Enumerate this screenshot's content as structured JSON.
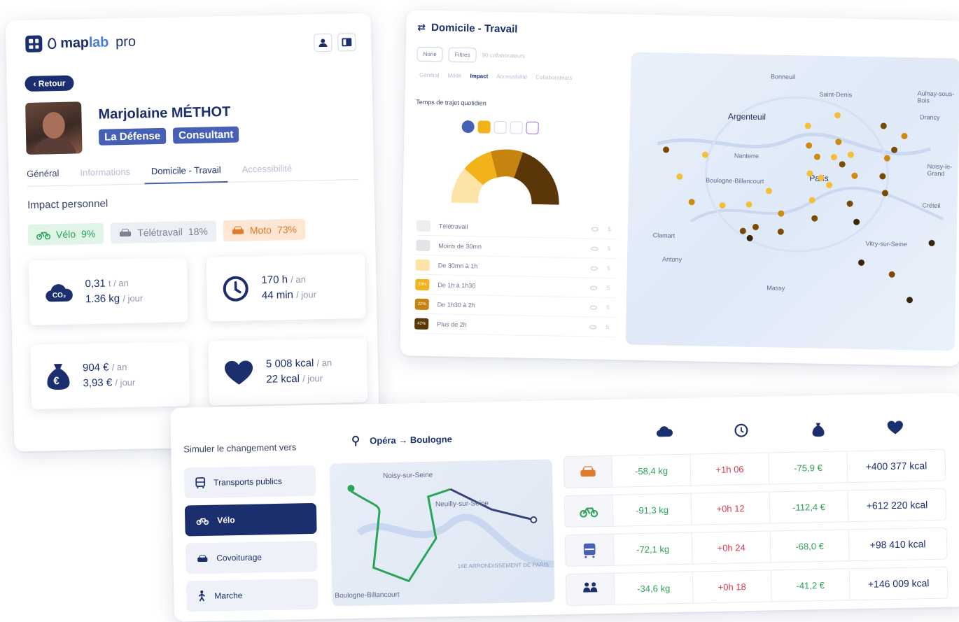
{
  "profile": {
    "brand_map": "map",
    "brand_lab": "lab",
    "brand_pro": "pro",
    "back_label": "‹ Retour",
    "name": "Marjolaine MÉTHOT",
    "tags": [
      "La Défense",
      "Consultant"
    ],
    "tabs": [
      "Général",
      "Informations",
      "Domicile - Travail",
      "Accessibilité"
    ],
    "active_tab": "Domicile - Travail",
    "impact_title": "Impact personnel",
    "modes": [
      {
        "icon": "bike-icon",
        "label": "Vélo",
        "pct": "9%",
        "color": "#2aa457"
      },
      {
        "icon": "car-icon",
        "label": "Télétravail",
        "pct": "18%",
        "color": "#7a8396"
      },
      {
        "icon": "car-icon",
        "label": "Moto",
        "pct": "73%",
        "color": "#e07a2c"
      }
    ],
    "stats": {
      "co2": {
        "v1": "0,31",
        "u1": "t / an",
        "v2": "1.36 kg",
        "u2": "/ jour"
      },
      "time": {
        "v1": "170 h",
        "u1": "/ an",
        "v2": "44 min",
        "u2": "/ jour"
      },
      "money": {
        "v1": "904 €",
        "u1": "/ an",
        "v2": "3,93 €",
        "u2": "/ jour"
      },
      "kcal": {
        "v1": "5 008 kcal",
        "u1": "/ an",
        "v2": "22 kcal",
        "u2": "/ jour"
      }
    }
  },
  "domicile": {
    "title": "Domicile - Travail",
    "filters": [
      "None",
      "Filtres"
    ],
    "collab_count": "90 collaborateurs",
    "tabs": [
      "Général",
      "Mode",
      "Impact",
      "Accessibilité",
      "Collaborateurs"
    ],
    "active_tab": "Impact",
    "chart_title": "Temps de trajet quotidien",
    "legend": [
      {
        "label": "Télétravail",
        "pct": "",
        "color": "#eeeef0"
      },
      {
        "label": "Moins de 30mn",
        "pct": "",
        "color": "#e4e4e8"
      },
      {
        "label": "De 30mn à 1h",
        "pct": "",
        "color": "#fde3a6"
      },
      {
        "label": "De 1h à 1h30",
        "pct": "10%",
        "color": "#f2b21a"
      },
      {
        "label": "De 1h30 à 2h",
        "pct": "22%",
        "color": "#c58410"
      },
      {
        "label": "Plus de 2h",
        "pct": "42%",
        "color": "#5a3608"
      }
    ],
    "map_cities": [
      "Bonneuil",
      "Saint-Denis",
      "Aulnay-sous-Bois",
      "Drancy",
      "Argenteuil",
      "Nanterre",
      "Paris",
      "Noisy-le-Grand",
      "Boulogne-Billancourt",
      "Créteil",
      "Clamart",
      "Vitry-sur-Seine",
      "Antony",
      "Massy"
    ]
  },
  "simulation": {
    "title": "Simuler le changement vers",
    "route": "Opéra → Boulogne",
    "options": [
      {
        "icon": "bus-icon",
        "label": "Transports publics"
      },
      {
        "icon": "bike-icon",
        "label": "Vélo"
      },
      {
        "icon": "car-icon",
        "label": "Covoiturage"
      },
      {
        "icon": "walk-icon",
        "label": "Marche"
      }
    ],
    "active_option": "Vélo",
    "map_labels": [
      "Noisy-sur-Seine",
      "Neuilly-sur-Seine",
      "16E ARRONDISSEMENT DE PARIS",
      "Boulogne-Billancourt"
    ],
    "rows": [
      {
        "icon": "car-icon",
        "co2": "-58,4 kg",
        "time": "+1h 06",
        "money": "-75,9 €",
        "kcal": "+400 377 kcal",
        "color": "#e07a2c"
      },
      {
        "icon": "bike-icon",
        "co2": "-91,3 kg",
        "time": "+0h 12",
        "money": "-112,4 €",
        "kcal": "+612 220 kcal",
        "color": "#2aa457"
      },
      {
        "icon": "bus-icon",
        "co2": "-72,1 kg",
        "time": "+0h 24",
        "money": "-68,0 €",
        "kcal": "+98 410 kcal",
        "color": "#4560b5"
      },
      {
        "icon": "walk-icon",
        "co2": "-34,6 kg",
        "time": "+0h 18",
        "money": "-41,2 €",
        "kcal": "+146 009 kcal",
        "color": "#1b2f6e"
      }
    ]
  }
}
